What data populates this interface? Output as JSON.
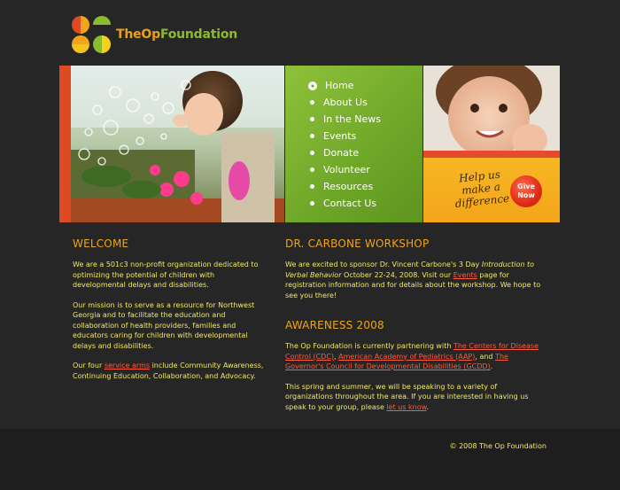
{
  "brand": {
    "name_the": "TheOp",
    "name_foundation": "Foundation",
    "colors": {
      "orange": "#e8a018",
      "green": "#8cbb2e",
      "red": "#e04a22"
    }
  },
  "nav": {
    "items": [
      {
        "label": "Home",
        "active": true
      },
      {
        "label": "About Us"
      },
      {
        "label": "In the News"
      },
      {
        "label": "Events"
      },
      {
        "label": "Donate"
      },
      {
        "label": "Volunteer"
      },
      {
        "label": "Resources"
      },
      {
        "label": "Contact Us"
      }
    ]
  },
  "promo": {
    "help_line1": "Help us",
    "help_line2": "make a",
    "help_line3": "difference",
    "give_line1": "Give",
    "give_line2": "Now"
  },
  "welcome": {
    "title": "WELCOME",
    "p1": "We are a 501c3 non-profit organization dedicated to optimizing the potential of children with developmental delays and disabilities.",
    "p2": "Our mission is to serve as a resource for Northwest Georgia and to facilitate the education and collaboration of health providers, families and educators caring for children with developmental delays and disabilities.",
    "p3_pre": "Our four ",
    "p3_link": "service arms",
    "p3_post": " include Community Awareness, Continuing Education, Collaboration, and Advocacy."
  },
  "workshop": {
    "title": "DR. CARBONE WORKSHOP",
    "pre": "We are excited to sponsor Dr. Vincent Carbone's 3 Day ",
    "italic": "Introduction to Verbal Behavior",
    "mid": " October 22-24, 2008. Visit our ",
    "link": "Events",
    "post": " page for registration information and for details about the workshop. We hope to see you there!"
  },
  "awareness": {
    "title": "AWARENESS 2008",
    "p1_pre": "The Op Foundation is currently partnering with ",
    "link1": "The Centers for Disease Control (CDC)",
    "sep1": ", ",
    "link2": "American Academy of Pediatrics (AAP)",
    "sep2": ", and ",
    "link3": "The Governor's Council for Developmental Disabilities (GCDD)",
    "p1_post": ".",
    "p2_pre": "This spring and summer, we will be speaking to a variety of organizations throughout the area. If you are interested in having us speak to your group, please ",
    "p2_link": "let us know",
    "p2_post": "."
  },
  "footer": {
    "copyright": "© 2008 The Op Foundation"
  }
}
